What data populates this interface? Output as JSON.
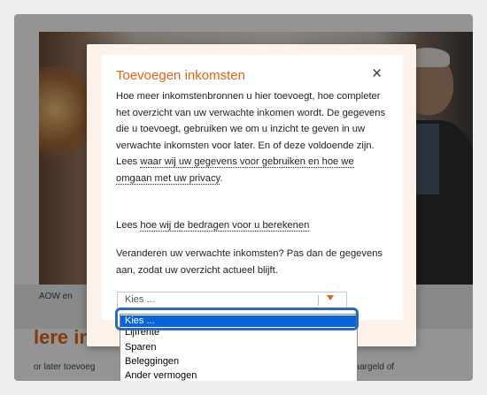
{
  "modal": {
    "title": "Toevoegen inkomsten",
    "close_symbol": "×",
    "p1_text": "Hoe meer inkomstenbronnen u hier toevoegt, hoe completer het overzicht van uw verwachte inkomen wordt. De gegevens die u toevoegt, gebruiken we om u inzicht te geven in uw verwachte inkomsten voor later. En of deze voldoende zijn. Lees ",
    "p1_link": "waar wij uw gegevens voor gebruiken en hoe we omgaan met uw privacy",
    "p1_end": ".",
    "p2_prefix": "Lees ",
    "p2_link": "hoe wij de bedragen voor u berekenen",
    "p3_text": "Veranderen uw verwachte inkomsten? Pas dan de gegevens aan, zodat uw overzicht actueel blijft."
  },
  "select": {
    "value": "Kies ...",
    "options": [
      "Kies ...",
      "Lijfrente",
      "Sparen",
      "Beleggingen",
      "Ander vermogen"
    ],
    "selected_index": 0
  },
  "background": {
    "aow_text": "AOW en",
    "heading": "lere inko",
    "later_text": "or later toevoeg",
    "spaar_text": "spaargeld of"
  },
  "colors": {
    "accent": "#e3631a",
    "selected": "#0a64d8",
    "highlight": "#2f6ab3"
  }
}
